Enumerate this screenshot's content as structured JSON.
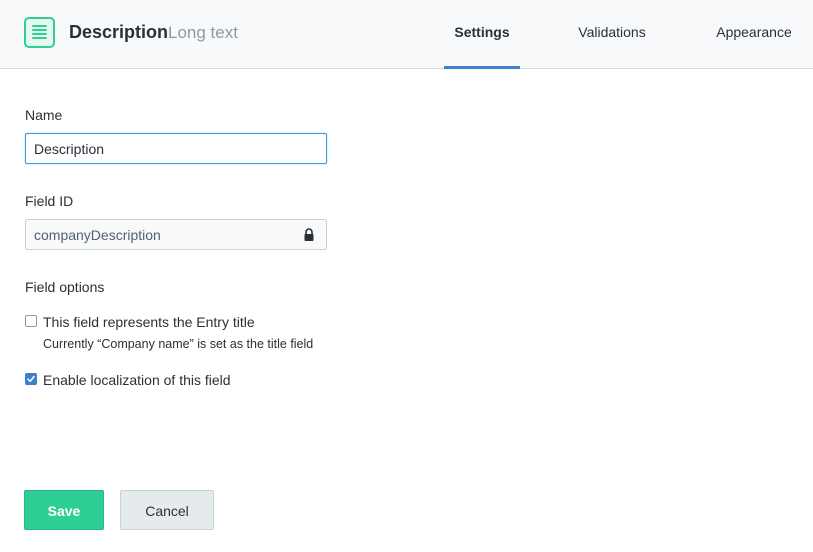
{
  "header": {
    "title": "Description",
    "subtitle": "Long text",
    "icon": "long-text-field-icon",
    "tabs": [
      {
        "label": "Settings",
        "active": true
      },
      {
        "label": "Validations",
        "active": false
      },
      {
        "label": "Appearance",
        "active": false
      }
    ]
  },
  "form": {
    "name_label": "Name",
    "name_value": "Description",
    "field_id_label": "Field ID",
    "field_id_value": "companyDescription",
    "field_options_label": "Field options",
    "options": [
      {
        "label": "This field represents the Entry title",
        "checked": false
      },
      {
        "label": "Enable localization of this field",
        "checked": true
      }
    ],
    "title_hint": "Currently “Company name” is set as the title field"
  },
  "actions": {
    "save_label": "Save",
    "cancel_label": "Cancel"
  },
  "colors": {
    "accent": "#3c80cf",
    "save_green": "#2ecf94",
    "header_bg": "#f7f9fa"
  }
}
